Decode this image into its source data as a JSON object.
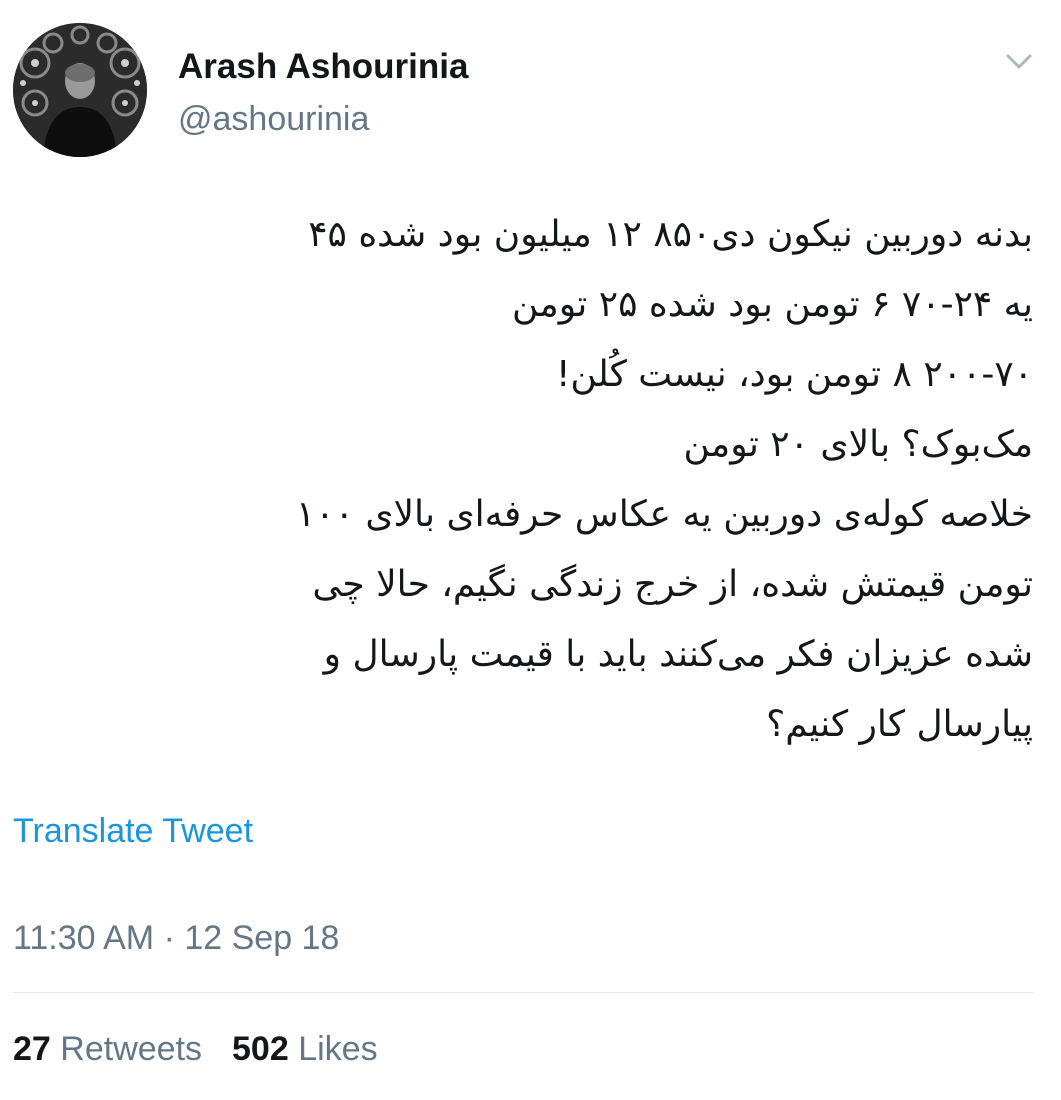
{
  "user": {
    "display_name": "Arash Ashourinia",
    "handle": "@ashourinia",
    "avatar_icon": "profile-photo"
  },
  "tweet": {
    "lines": [
      "بدنه دوربین نیکون دی۸۵۰ ۱۲ میلیون بود شده ۴۵",
      "یه ۲۴-۷۰ ۶ تومن بود شده ۲۵ تومن",
      "۲۰۰-۷۰ ۸ تومن بود، نیست کُلن!",
      "مک‌بوک؟ بالای ۲۰ تومن",
      "خلاصه کوله‌ی دوربین یه عکاس حرفه‌ای بالای ۱۰۰",
      "تومن قیمتش شده، از خرج زندگی نگیم، حالا چی",
      "شده عزیزان فکر می‌کنند باید با قیمت پارسال و",
      "پیارسال کار کنیم؟"
    ],
    "translate_label": "Translate Tweet",
    "timestamp": "11:30 AM · 12 Sep 18"
  },
  "stats": {
    "retweets_count": "27",
    "retweets_label": "Retweets",
    "likes_count": "502",
    "likes_label": "Likes"
  },
  "colors": {
    "link": "#1b95e0",
    "secondary": "#657786",
    "primary": "#14171a",
    "divider": "#e1e8ed"
  },
  "icons": {
    "menu": "chevron-down-icon"
  }
}
